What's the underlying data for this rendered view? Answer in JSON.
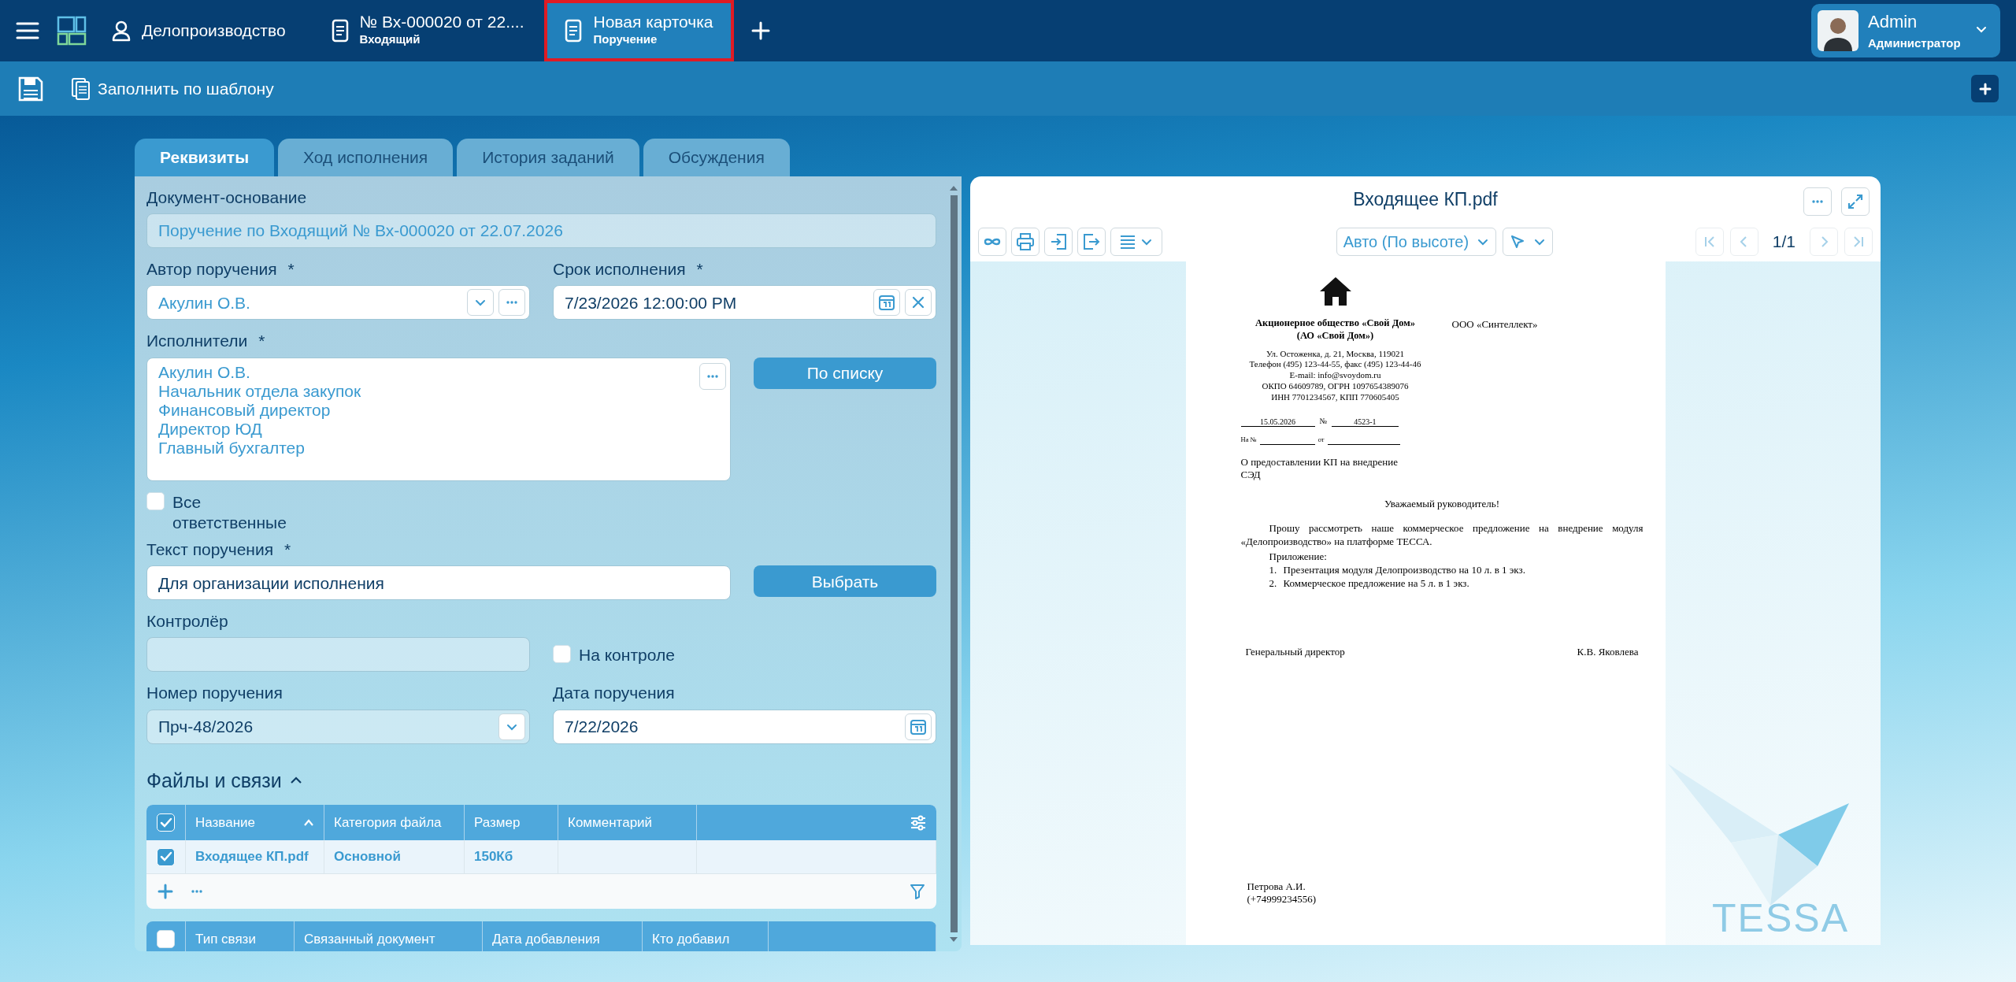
{
  "topbar": {
    "module": "Делопроизводство",
    "open_cards": [
      {
        "title": "№ Вх-000020 от 22....",
        "subtitle": "Входящий",
        "selected": false
      },
      {
        "title": "Новая карточка",
        "subtitle": "Поручение",
        "selected": true
      }
    ],
    "user": {
      "name": "Admin",
      "role": "Администратор"
    }
  },
  "toolbar": {
    "template_button": "Заполнить по шаблону"
  },
  "tabs": [
    {
      "label": "Реквизиты",
      "selected": true
    },
    {
      "label": "Ход исполнения",
      "selected": false
    },
    {
      "label": "История заданий",
      "selected": false
    },
    {
      "label": "Обсуждения",
      "selected": false
    }
  ],
  "form": {
    "basis": {
      "label": "Документ-основание",
      "readonly": true,
      "value": "Поручение по Входящий № Вх-000020 от 22.07.2026"
    },
    "author": {
      "label": "Автор поручения",
      "required_mark": "*",
      "readonly": false,
      "value": "Акулин О.В."
    },
    "deadline": {
      "label": "Срок исполнения",
      "required_mark": "*",
      "readonly": false,
      "value": "7/23/2026 12:00:00 PM"
    },
    "performers": {
      "label": "Исполнители",
      "required_mark": "*",
      "readonly": false,
      "values": [
        "Акулин О.В.",
        "Начальник отдела закупок",
        "Финансовый директор",
        "Директор ЮД",
        "Главный бухгалтер"
      ],
      "button": "По списку"
    },
    "all_responsible": {
      "label": "Все ответственные",
      "checked": false
    },
    "task_text": {
      "label": "Текст поручения",
      "required_mark": "*",
      "readonly": false,
      "value": "Для организации исполнения",
      "button": "Выбрать"
    },
    "controller": {
      "label": "Контролёр",
      "readonly": true
    },
    "on_control": {
      "label": "На контроле",
      "checked": false
    },
    "number": {
      "label": "Номер поручения",
      "readonly": true,
      "value": "Прч-48/2026"
    },
    "date": {
      "label": "Дата поручения",
      "readonly": false,
      "value": "7/22/2026"
    }
  },
  "files": {
    "title": "Файлы и связи",
    "expanded": true,
    "all_selected": true,
    "columns": [
      {
        "label": "Название",
        "sort_ascending": true
      },
      {
        "label": "Категория файла"
      },
      {
        "label": "Размер"
      },
      {
        "label": "Комментарий"
      }
    ],
    "rows": [
      {
        "selected": true,
        "cells": [
          "Входящее КП.pdf",
          "Основной",
          "150Кб",
          ""
        ]
      }
    ]
  },
  "links": {
    "all_selected": false,
    "columns": [
      "Тип связи",
      "Связанный документ",
      "Дата добавления",
      "Кто добавил"
    ]
  },
  "viewer": {
    "title": "Входящее КП.pdf",
    "zoom": "Авто (По высоте)",
    "page": "1/1",
    "document": {
      "company": [
        "Акционерное общество «Свой Дом»",
        "(АО «Свой Дом»)"
      ],
      "recipient": "ООО «Синтеллект»",
      "address": [
        "Ул. Остоженка, д. 21, Москва, 119021",
        "Телефон (495) 123-44-55, факс (495) 123-44-46",
        "E-mail: info@svoydom.ru",
        "ОКПО 64609789, ОГРН 1097654389076",
        "ИНН 7701234567, КПП 770605405"
      ],
      "date": "15.05.2026",
      "number_label": "№",
      "number": "4523-1",
      "ref_label": "На №",
      "ref_from": "от",
      "subject": [
        "О предоставлении КП на внедрение",
        "СЭД"
      ],
      "greeting": "Уважаемый руководитель!",
      "body": "Прошу рассмотреть наше коммерческое предложение на внедрение модуля «Делопроизводство» на платформе ТЕССА.",
      "attachments_label": "Приложение:",
      "attachments": [
        {
          "number": "1.",
          "text": "Презентация модуля Делопроизводство на 10 л. в 1 экз."
        },
        {
          "number": "2.",
          "text": "Коммерческое предложение на 5 л. в 1 экз."
        }
      ],
      "signer_title": "Генеральный директор",
      "signer_name": "К.В. Яковлева",
      "executor": [
        "Петрова А.И.",
        "(+74999234556)"
      ]
    }
  },
  "brand": "TESSA"
}
